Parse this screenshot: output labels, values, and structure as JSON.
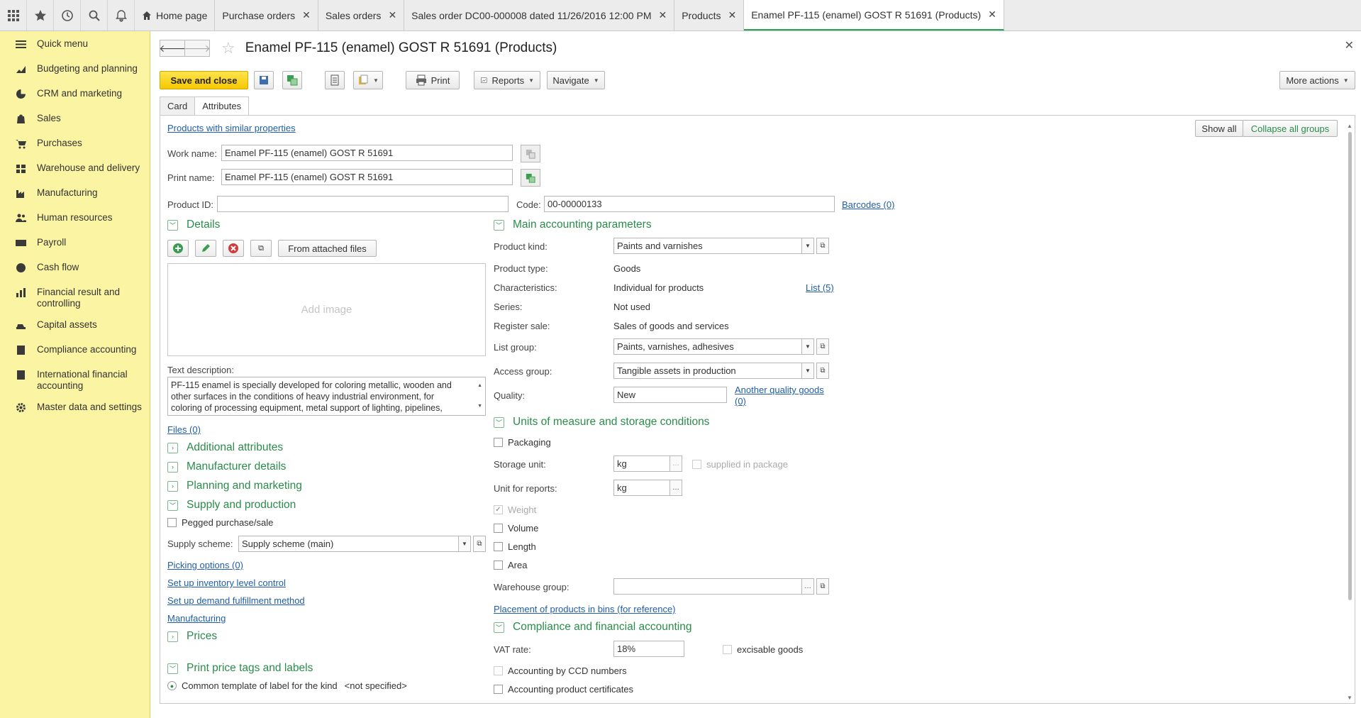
{
  "topbar": {
    "tabs": [
      {
        "label": "Home page"
      },
      {
        "label": "Purchase orders"
      },
      {
        "label": "Sales orders"
      },
      {
        "label": "Sales order DC00-000008 dated 11/26/2016 12:00 PM"
      },
      {
        "label": "Products"
      },
      {
        "label": "Enamel PF-115 (enamel) GOST R 51691 (Products)"
      }
    ]
  },
  "sidebar": {
    "items": [
      {
        "label": "Quick menu",
        "icon": "menu-icon"
      },
      {
        "label": "Budgeting and planning",
        "icon": "budget-icon"
      },
      {
        "label": "CRM and marketing",
        "icon": "crm-icon"
      },
      {
        "label": "Sales",
        "icon": "sales-icon"
      },
      {
        "label": "Purchases",
        "icon": "cart-icon"
      },
      {
        "label": "Warehouse and delivery",
        "icon": "warehouse-icon"
      },
      {
        "label": "Manufacturing",
        "icon": "factory-icon"
      },
      {
        "label": "Human resources",
        "icon": "people-icon"
      },
      {
        "label": "Payroll",
        "icon": "payroll-icon"
      },
      {
        "label": "Cash flow",
        "icon": "cash-icon"
      },
      {
        "label": "Financial result and controlling",
        "icon": "chart-icon"
      },
      {
        "label": "Capital assets",
        "icon": "assets-icon"
      },
      {
        "label": "Compliance accounting",
        "icon": "ledger-icon"
      },
      {
        "label": "International financial accounting",
        "icon": "globe-icon"
      },
      {
        "label": "Master data and settings",
        "icon": "gear-icon"
      }
    ]
  },
  "form": {
    "title": "Enamel PF-115 (enamel) GOST R 51691 (Products)",
    "toolbar": {
      "save_close": "Save and close",
      "print": "Print",
      "reports": "Reports",
      "navigate": "Navigate",
      "more_actions": "More actions"
    },
    "tabs": [
      "Card",
      "Attributes"
    ],
    "links": {
      "similar": "Products with similar properties",
      "barcodes": "Barcodes (0)",
      "files": "Files (0)",
      "list5": "List (5)",
      "another_quality": "Another quality goods",
      "another_quality_count": "(0)",
      "picking": "Picking options (0)",
      "inventory": "Set up inventory level control",
      "demand": "Set up demand fulfillment method",
      "manufacturing": "Manufacturing",
      "placement": "Placement of products in bins (for reference)"
    },
    "show_all": "Show all",
    "collapse_all": "Collapse all groups",
    "work_name_label": "Work name:",
    "work_name": "Enamel PF-115 (enamel) GOST R 51691",
    "print_name_label": "Print name:",
    "print_name": "Enamel PF-115 (enamel) GOST R 51691",
    "product_id_label": "Product ID:",
    "product_id": "",
    "code_label": "Code:",
    "code": "00-00000133",
    "details": {
      "title": "Details",
      "from_files": "From attached files",
      "add_image": "Add image",
      "text_desc_label": "Text description:",
      "text_desc_lines": [
        "PF-115 enamel is specially developed for coloring metallic, wooden and",
        "other surfaces in the conditions of heavy industrial environment, for",
        "coloring of processing equipment, metal support of lighting, pipelines,"
      ]
    },
    "groups_left": {
      "additional": "Additional attributes",
      "manufacturer": "Manufacturer details",
      "planning": "Planning and marketing",
      "supply": "Supply and production",
      "prices": "Prices",
      "print_tags": "Print price tags and labels"
    },
    "pegged": "Pegged purchase/sale",
    "supply_scheme_label": "Supply scheme:",
    "supply_scheme": "Supply scheme (main)",
    "label_template": "Common template of label for the kind",
    "not_specified": "<not specified>",
    "main_params": {
      "title": "Main accounting parameters",
      "product_kind_label": "Product kind:",
      "product_kind": "Paints and varnishes",
      "product_type_label": "Product type:",
      "product_type": "Goods",
      "characteristics_label": "Characteristics:",
      "characteristics": "Individual for products",
      "series_label": "Series:",
      "series": "Not used",
      "register_sale_label": "Register sale:",
      "register_sale": "Sales of goods and services",
      "list_group_label": "List group:",
      "list_group": "Paints, varnishes, adhesives",
      "access_group_label": "Access group:",
      "access_group": "Tangible assets in production",
      "quality_label": "Quality:",
      "quality": "New"
    },
    "units": {
      "title": "Units of measure and storage conditions",
      "packaging": "Packaging",
      "storage_unit_label": "Storage unit:",
      "storage_unit": "kg",
      "supplied_in_package": "supplied in package",
      "unit_reports_label": "Unit for reports:",
      "unit_reports": "kg",
      "weight": "Weight",
      "volume": "Volume",
      "length": "Length",
      "area": "Area",
      "warehouse_group_label": "Warehouse group:",
      "warehouse_group": ""
    },
    "compliance": {
      "title": "Compliance and financial accounting",
      "vat_label": "VAT rate:",
      "vat": "18%",
      "excisable": "excisable goods",
      "ccd": "Accounting by CCD numbers",
      "certificates": "Accounting product certificates"
    }
  },
  "colors": {
    "accent": "#2a8c4a",
    "sidebar": "#fbf4a2",
    "primary_button": "#f5c800",
    "link": "#1f5ea8"
  }
}
